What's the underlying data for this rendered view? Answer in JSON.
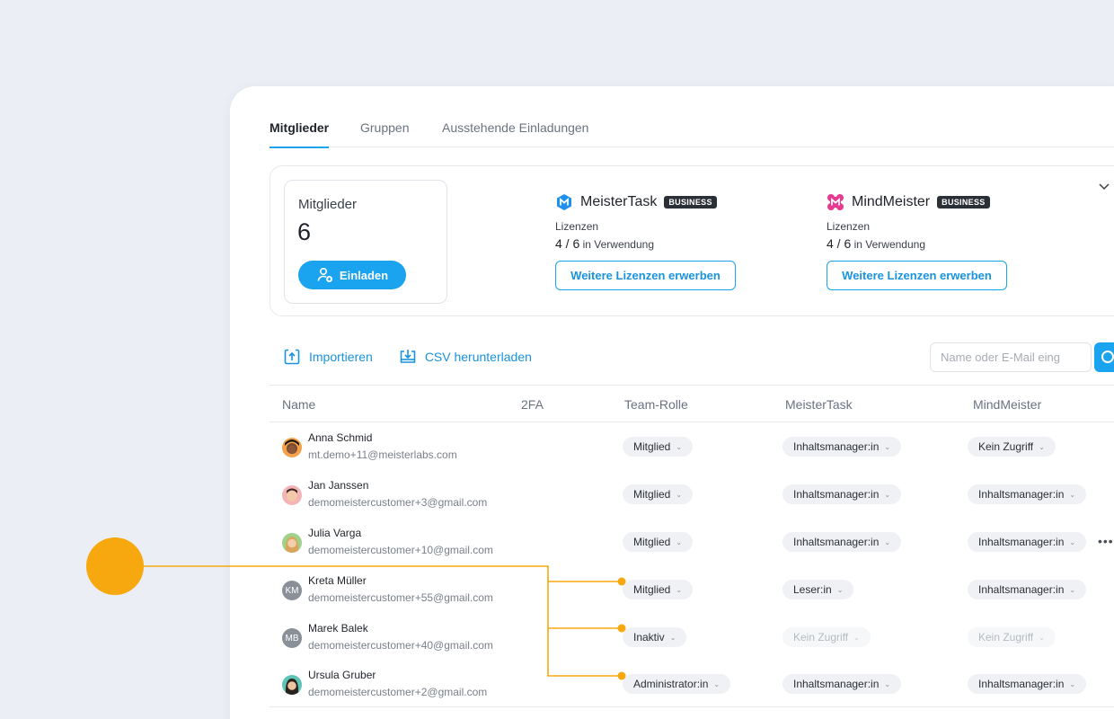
{
  "tabs": [
    {
      "label": "Mitglieder",
      "active": true
    },
    {
      "label": "Gruppen",
      "active": false
    },
    {
      "label": "Ausstehende Einladungen",
      "active": false
    }
  ],
  "summary": {
    "members_label": "Mitglieder",
    "members_count": "6",
    "invite_label": "Einladen",
    "products": [
      {
        "name": "MeisterTask",
        "badge": "BUSINESS",
        "icon": "meistertask-logo",
        "color": "#1f8ff0",
        "licenses_label": "Lizenzen",
        "used": "4 / 6",
        "used_suffix": "in Verwendung",
        "button": "Weitere Lizenzen erwerben"
      },
      {
        "name": "MindMeister",
        "badge": "BUSINESS",
        "icon": "mindmeister-logo",
        "color": "#e8398f",
        "licenses_label": "Lizenzen",
        "used": "4 / 6",
        "used_suffix": "in Verwendung",
        "button": "Weitere Lizenzen erwerben"
      }
    ]
  },
  "toolbar": {
    "import_label": "Importieren",
    "csv_label": "CSV herunterladen",
    "search_placeholder": "Name oder E-Mail eing"
  },
  "table": {
    "columns": [
      "Name",
      "2FA",
      "Team-Rolle",
      "MeisterTask",
      "MindMeister"
    ],
    "rows": [
      {
        "name": "Anna Schmid",
        "email": "mt.demo+11@meisterlabs.com",
        "avatar": "photo",
        "team_role": "Mitglied",
        "meistertask": "Inhaltsmanager:in",
        "mindmeister": "Kein Zugriff"
      },
      {
        "name": "Jan Janssen",
        "email": "demomeistercustomer+3@gmail.com",
        "avatar": "photo",
        "team_role": "Mitglied",
        "meistertask": "Inhaltsmanager:in",
        "mindmeister": "Inhaltsmanager:in"
      },
      {
        "name": "Julia Varga",
        "email": "demomeistercustomer+10@gmail.com",
        "avatar": "photo",
        "team_role": "Mitglied",
        "meistertask": "Inhaltsmanager:in",
        "mindmeister": "Inhaltsmanager:in",
        "more": "•••"
      },
      {
        "name": "Kreta Müller",
        "email": "demomeistercustomer+55@gmail.com",
        "avatar": "KM",
        "team_role": "Mitglied",
        "meistertask": "Leser:in",
        "mindmeister": "Inhaltsmanager:in"
      },
      {
        "name": "Marek Balek",
        "email": "demomeistercustomer+40@gmail.com",
        "avatar": "MB",
        "team_role": "Inaktiv",
        "meistertask": "Kein Zugriff",
        "mindmeister": "Kein Zugriff",
        "inactive": true
      },
      {
        "name": "Ursula Gruber",
        "email": "demomeistercustomer+2@gmail.com",
        "avatar": "photo",
        "team_role": "Administrator:in",
        "meistertask": "Inhaltsmanager:in",
        "mindmeister": "Inhaltsmanager:in"
      }
    ]
  },
  "colors": {
    "accent": "#1aa3ee",
    "annotation": "#f7a80f",
    "background": "#eceef6"
  }
}
